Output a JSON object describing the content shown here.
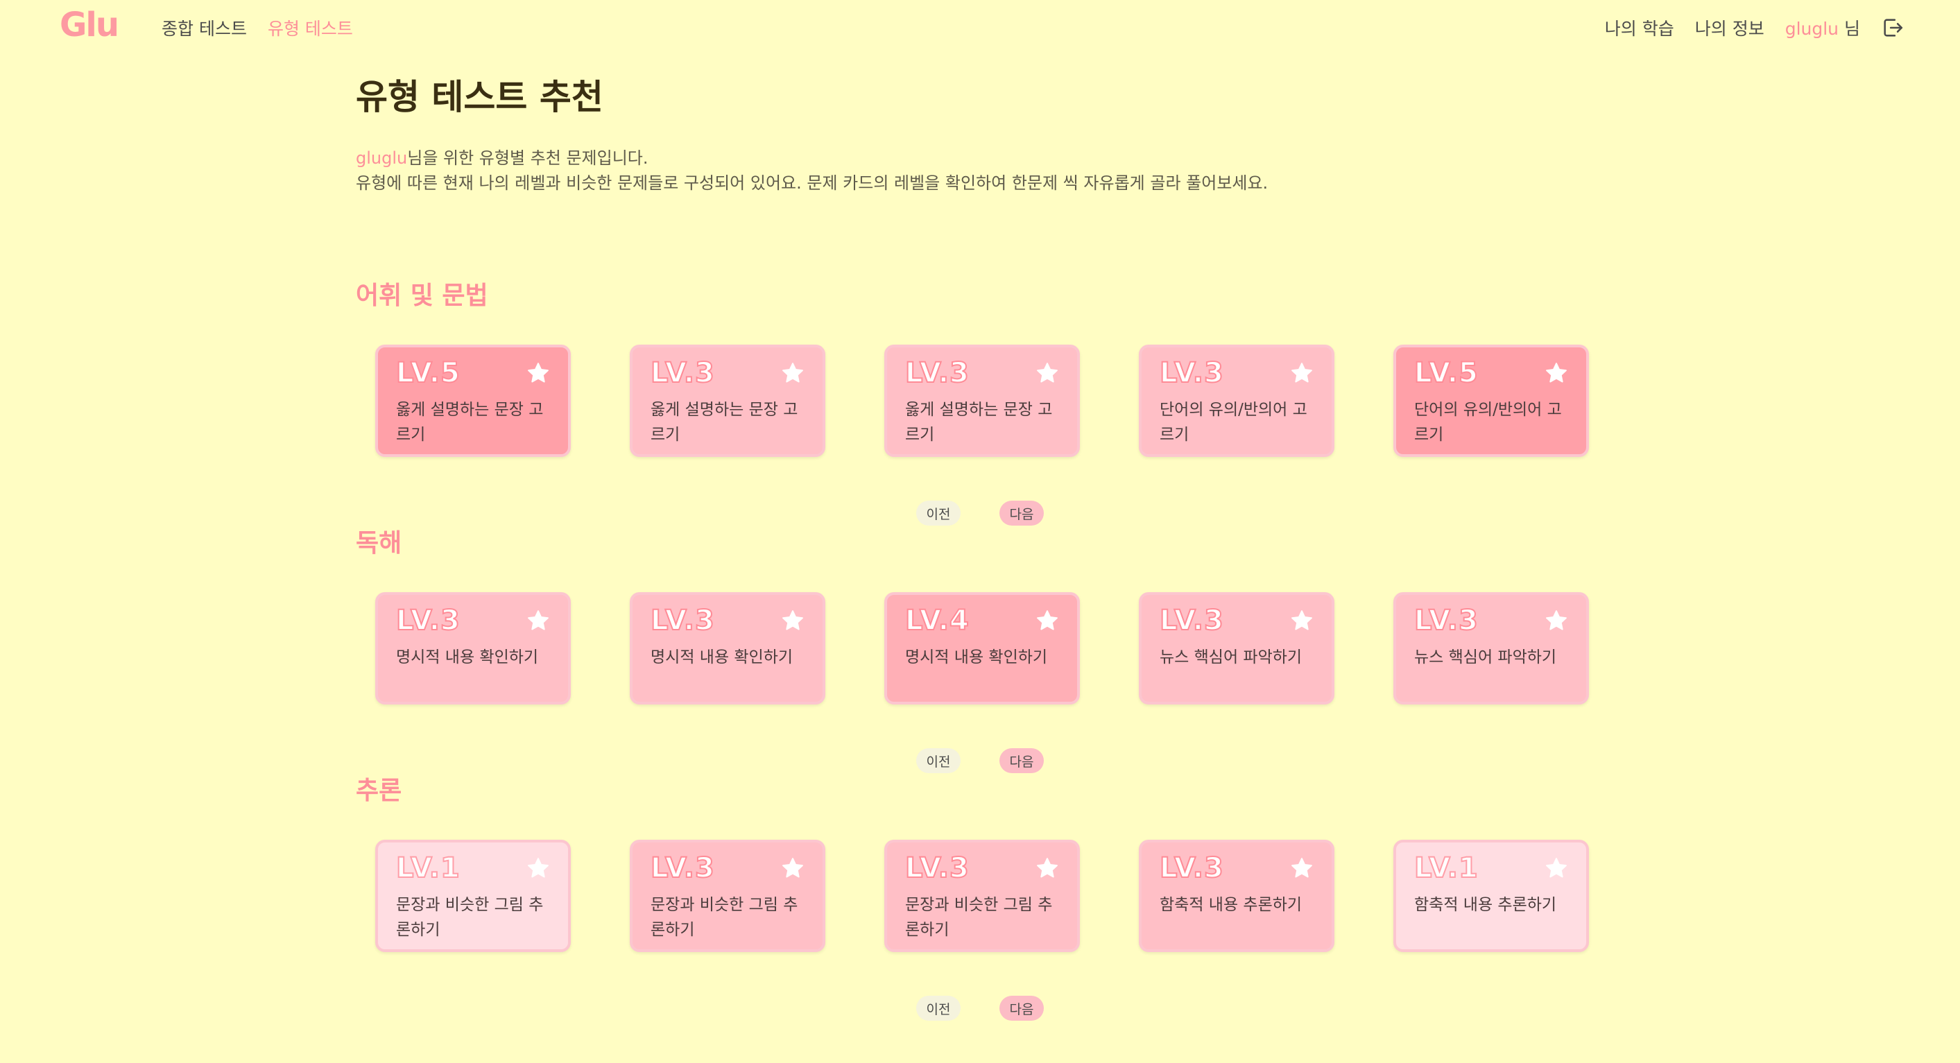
{
  "nav": {
    "logo": "Glu",
    "links": [
      "종합 테스트",
      "유형 테스트"
    ],
    "my_study": "나의 학습",
    "my_info": "나의 정보",
    "user_name": "gluglu",
    "user_suffix": "님",
    "logout_icon": "logout-icon"
  },
  "header": {
    "title": "유형 테스트 추천",
    "desc_user": "gluglu",
    "desc_line1_rest": "님을 위한 유형별 추천 문제입니다.",
    "desc_line2": "유형에 따른 현재 나의 레벨과 비슷한 문제들로 구성되어 있어요. 문제 카드의 레벨을 확인하여 한문제 씩 자유롭게 골라 풀어보세요."
  },
  "sections": [
    {
      "title": "어휘 및 문법",
      "cards": [
        {
          "level": "LV.5",
          "title": "옳게 설명하는 문장 고르기"
        },
        {
          "level": "LV.3",
          "title": "옳게 설명하는 문장 고르기"
        },
        {
          "level": "LV.3",
          "title": "옳게 설명하는 문장 고르기"
        },
        {
          "level": "LV.3",
          "title": "단어의 유의/반의어 고르기"
        },
        {
          "level": "LV.5",
          "title": "단어의 유의/반의어 고르기"
        }
      ],
      "prev": "이전",
      "next": "다음"
    },
    {
      "title": "독해",
      "cards": [
        {
          "level": "LV.3",
          "title": "명시적 내용 확인하기"
        },
        {
          "level": "LV.3",
          "title": "명시적 내용 확인하기"
        },
        {
          "level": "LV.4",
          "title": "명시적 내용 확인하기"
        },
        {
          "level": "LV.3",
          "title": "뉴스 핵심어 파악하기"
        },
        {
          "level": "LV.3",
          "title": "뉴스 핵심어 파악하기"
        }
      ],
      "prev": "이전",
      "next": "다음"
    },
    {
      "title": "추론",
      "cards": [
        {
          "level": "LV.1",
          "title": "문장과 비슷한 그림 추론하기"
        },
        {
          "level": "LV.3",
          "title": "문장과 비슷한 그림 추론하기"
        },
        {
          "level": "LV.3",
          "title": "문장과 비슷한 그림 추론하기"
        },
        {
          "level": "LV.3",
          "title": "함축적 내용 추론하기"
        },
        {
          "level": "LV.1",
          "title": "함축적 내용 추론하기"
        }
      ],
      "prev": "이전",
      "next": "다음"
    }
  ],
  "colors": {
    "background": "#fffdc3",
    "accent": "#fd8f99",
    "card_lv1": "#ffdde2",
    "card_lv3": "#ffbfc6",
    "card_lv4": "#ffafb6",
    "card_lv5": "#ffa0a8"
  }
}
